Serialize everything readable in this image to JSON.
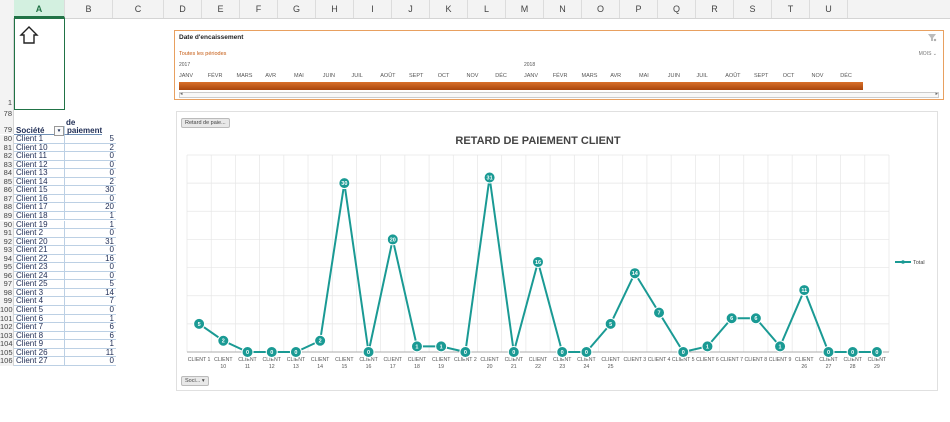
{
  "columns": [
    "A",
    "B",
    "C",
    "D",
    "E",
    "F",
    "G",
    "H",
    "I",
    "J",
    "K",
    "L",
    "M",
    "N",
    "O",
    "P",
    "Q",
    "R",
    "S",
    "T",
    "U"
  ],
  "row_numbers": {
    "top_cell": "1",
    "gap_row": "78",
    "start": 79
  },
  "table": {
    "header_top": "de",
    "header_col1": "Société",
    "header_col2": "paiement",
    "rows": [
      [
        "Client 1",
        "5"
      ],
      [
        "Client 10",
        "2"
      ],
      [
        "Client 11",
        "0"
      ],
      [
        "Client 12",
        "0"
      ],
      [
        "Client 13",
        "0"
      ],
      [
        "Client 14",
        "2"
      ],
      [
        "Client 15",
        "30"
      ],
      [
        "Client 16",
        "0"
      ],
      [
        "Client 17",
        "20"
      ],
      [
        "Client 18",
        "1"
      ],
      [
        "Client 19",
        "1"
      ],
      [
        "Client 2",
        "0"
      ],
      [
        "Client 20",
        "31"
      ],
      [
        "Client 21",
        "0"
      ],
      [
        "Client 22",
        "16"
      ],
      [
        "Client 23",
        "0"
      ],
      [
        "Client 24",
        "0"
      ],
      [
        "Client 25",
        "5"
      ],
      [
        "Client 3",
        "14"
      ],
      [
        "Client 4",
        "7"
      ],
      [
        "Client 5",
        "0"
      ],
      [
        "Client 6",
        "1"
      ],
      [
        "Client 7",
        "6"
      ],
      [
        "Client 8",
        "6"
      ],
      [
        "Client 9",
        "1"
      ],
      [
        "Client 26",
        "11"
      ],
      [
        "Client 27",
        "0"
      ]
    ]
  },
  "timeline": {
    "title": "Date d'encaissement",
    "period": "Toutes les périodes",
    "level": "MOIS",
    "year1": "2017",
    "year2": "2018",
    "months": [
      "JANV",
      "FÉVR",
      "MARS",
      "AVR",
      "MAI",
      "JUIN",
      "JUIL",
      "AOÛT",
      "SEPT",
      "OCT",
      "NOV",
      "DÉC",
      "JANV",
      "FÉVR",
      "MARS",
      "AVR",
      "MAI",
      "JUIN",
      "JUIL",
      "AOÛT",
      "SEPT",
      "OCT",
      "NOV",
      "DÉC"
    ],
    "bar_color": "#c55a11"
  },
  "chart_button": "Retard de paie...",
  "filter_button": "Soci...",
  "chart_data": {
    "type": "line",
    "title": "RETARD DE PAIEMENT CLIENT",
    "categories": [
      "CLIENT 1",
      "CLIENT 10",
      "CLIENT 11",
      "CLIENT 12",
      "CLIENT 13",
      "CLIENT 14",
      "CLIENT 15",
      "CLIENT 16",
      "CLIENT 17",
      "CLIENT 18",
      "CLIENT 19",
      "CLIENT 2",
      "CLIENT 20",
      "CLIENT 21",
      "CLIENT 22",
      "CLIENT 23",
      "CLIENT 24",
      "CLIENT 25",
      "CLIENT 3",
      "CLIENT 4",
      "CLIENT 5",
      "CLIENT 6",
      "CLIENT 7",
      "CLIENT 8",
      "CLIENT 9",
      "CLIENT 26",
      "CLIENT 27",
      "CLIENT 28",
      "CLIENT 29"
    ],
    "series": [
      {
        "name": "Total",
        "values": [
          5,
          2,
          0,
          0,
          0,
          2,
          30,
          0,
          20,
          1,
          1,
          0,
          31,
          0,
          16,
          0,
          0,
          5,
          14,
          7,
          0,
          1,
          6,
          6,
          1,
          11,
          0,
          0,
          0
        ]
      }
    ],
    "ylim": [
      0,
      35
    ],
    "legend": "right",
    "color": "#1a9a94",
    "grid": true
  }
}
